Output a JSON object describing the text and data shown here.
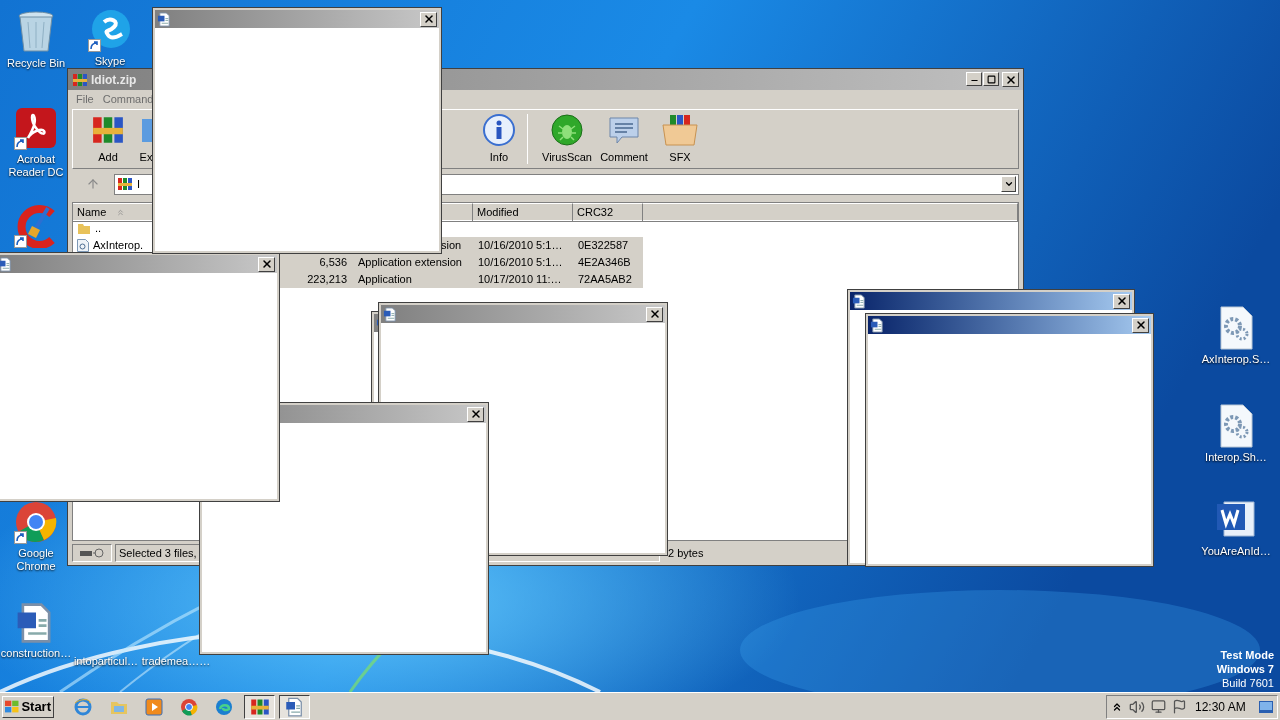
{
  "desktop_icons": [
    {
      "label": "Recycle Bin",
      "kind": "recycle",
      "shortcut": false
    },
    {
      "label": "Skype",
      "kind": "chat",
      "shortcut": true
    },
    {
      "label": "Acrobat Reader DC",
      "kind": "pdf",
      "shortcut": true
    },
    {
      "kind": "cleaner",
      "shortcut": true
    },
    {
      "label": "Google Chrome",
      "kind": "browser",
      "shortcut": true
    },
    {
      "label": "construction…",
      "kind": "doc",
      "shortcut": false
    },
    {
      "label": "intoparticul…",
      "kind": "blank"
    },
    {
      "label": "trademea……",
      "kind": "blank"
    },
    {
      "label": "AxInterop.S…",
      "kind": "gearfile",
      "shortcut": false
    },
    {
      "label": "Interop.Sh…",
      "kind": "gearfile",
      "shortcut": false
    },
    {
      "label": "YouAreAnId…",
      "kind": "word",
      "shortcut": false
    }
  ],
  "archiver": {
    "title": "Idiot.zip",
    "menu": [
      "File",
      "Command"
    ],
    "toolbar": [
      {
        "label": "Add",
        "kind": "add"
      },
      {
        "label": "Ex",
        "kind": "extract"
      },
      {
        "label": "Info",
        "kind": "info"
      },
      {
        "label": "VirusScan",
        "kind": "scan"
      },
      {
        "label": "Comment",
        "kind": "comment"
      },
      {
        "label": "SFX",
        "kind": "sfx"
      }
    ],
    "address": "I",
    "columns": [
      "Name",
      "Modified",
      "CRC32"
    ],
    "rows": [
      {
        "name": "..",
        "kind": "folder",
        "selected": false
      },
      {
        "name": "AxInterop.",
        "kind": "file",
        "type": "sion",
        "modified": "10/16/2010 5:1…",
        "crc": "0E322587",
        "selected": true
      },
      {
        "size": "6,536",
        "type": "Application extension",
        "modified": "10/16/2010 5:1…",
        "crc": "4E2A346B",
        "selected": true
      },
      {
        "size": "223,213",
        "type": "Application",
        "modified": "10/17/2010 11:…",
        "crc": "72AA5AB2",
        "selected": true
      }
    ],
    "status_left": "Selected 3 files,",
    "status_right": "2 bytes"
  },
  "popups": [
    {
      "active": true
    },
    {
      "active": true
    },
    {
      "active": false
    },
    {
      "active": false
    },
    {
      "active": false
    },
    {
      "active": false
    },
    {
      "active": false
    }
  ],
  "os_notice": [
    "Test Mode",
    "Windows 7",
    "Build 7601"
  ],
  "taskbar": {
    "start": "Start",
    "apps": [
      {
        "kind": "ie",
        "selected": false
      },
      {
        "kind": "explorer",
        "selected": false
      },
      {
        "kind": "media",
        "selected": false
      },
      {
        "kind": "browser",
        "selected": false
      },
      {
        "kind": "edge",
        "selected": false
      },
      {
        "kind": "archive",
        "selected": true
      },
      {
        "kind": "word",
        "selected": true
      }
    ],
    "clock": "12:30 AM"
  }
}
